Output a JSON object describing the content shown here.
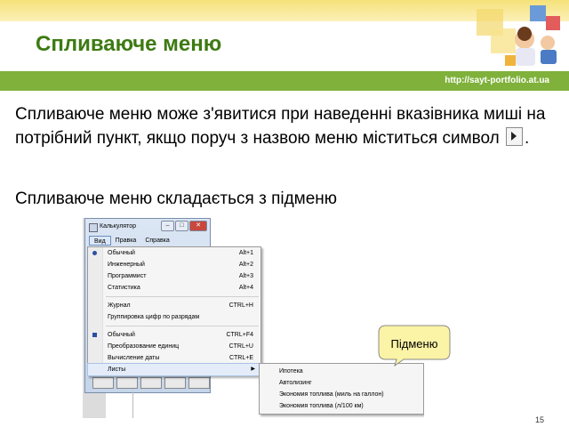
{
  "slide": {
    "title": "Спливаюче меню",
    "site": "http://sayt-portfolio.at.ua",
    "paragraph1_before": "Спливаюче меню може з'явитися при наведенні вказівника миші на потрібний пункт, якщо поруч з назвою меню міститься символ",
    "paragraph1_after": ".",
    "paragraph2": "Спливаюче меню складається з підменю",
    "callout": "Підменю",
    "page_number": "15"
  },
  "calculator": {
    "title": "Калькулятор",
    "menubar": [
      "Вид",
      "Правка",
      "Справка"
    ],
    "menu_items": [
      {
        "label": "Обычный",
        "shortcut": "Alt+1",
        "mark": "radio"
      },
      {
        "label": "Инженерный",
        "shortcut": "Alt+2"
      },
      {
        "label": "Программист",
        "shortcut": "Alt+3"
      },
      {
        "label": "Статистика",
        "shortcut": "Alt+4"
      },
      {
        "label": "Журнал",
        "shortcut": "CTRL+H"
      },
      {
        "label": "Группировка цифр по разрядам",
        "shortcut": ""
      },
      {
        "label": "Обычный",
        "shortcut": "CTRL+F4",
        "mark": "check"
      },
      {
        "label": "Преобразование единиц",
        "shortcut": "CTRL+U"
      },
      {
        "label": "Вычисление даты",
        "shortcut": "CTRL+E"
      },
      {
        "label": "Листы",
        "shortcut": ""
      }
    ],
    "submenu_items": [
      "Ипотека",
      "Автолизинг",
      "Экономия топлива (миль на галлон)",
      "Экономия топлива (л/100 км)"
    ]
  },
  "colors": {
    "title_green": "#3d7a12",
    "bar_green": "#7fb13b",
    "top_yellow": "#f6e27a",
    "callout_yellow": "#fbf3a6"
  }
}
